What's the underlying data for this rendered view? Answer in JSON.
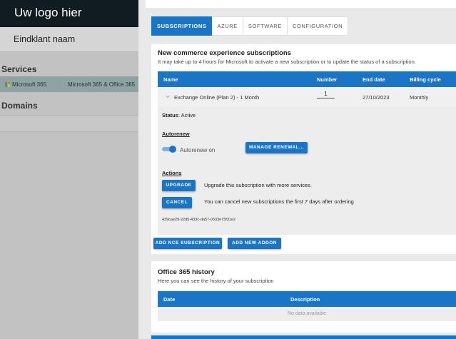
{
  "sidebar": {
    "logo": "Uw logo hier",
    "customer": "Eindklant naam",
    "services_heading": "Services",
    "service": {
      "name": "Microsoft 365",
      "type": "Microsoft 365 & Office 365"
    },
    "domains_heading": "Domains"
  },
  "tabs": [
    "SUBSCRIPTIONS",
    "AZURE",
    "SOFTWARE",
    "CONFIGURATION"
  ],
  "nce": {
    "title": "New commerce experience subscriptions",
    "subtitle": "It may take up to 4 hours for Microsoft to activate a new subscription or to update the status of a subscription.",
    "columns": [
      "Name",
      "Number",
      "End date",
      "Billing cycle"
    ],
    "row": {
      "name": "Exchange Online (Plan 2) - 1 Month",
      "number": "1",
      "end_date": "27/10/2023",
      "billing": "Monthly"
    },
    "status_label": "Status",
    "status_value": ": Active",
    "autorenew_heading": "Autorenew",
    "autorenew_label": "Autorenew on",
    "autorenew_on": true,
    "manage_renewal": "MANAGE RENEWAL...",
    "actions_heading": "Actions",
    "upgrade_button": "UPGRADE",
    "upgrade_text": "Upgrade this subscription with more services.",
    "cancel_button": "CANCEL",
    "cancel_text": "You can cancel new subscriptions the first 7 days after ordering",
    "subscription_id": "439cae29-22d5-433c-da57-0633e75f31e2",
    "add_nce": "ADD NCE SUBSCRIPTION",
    "add_addon": "ADD NEW ADDON"
  },
  "history": {
    "title": "Office 365 history",
    "subtitle": "Here you can see the history of your subscription",
    "columns": [
      "Date",
      "Description"
    ],
    "empty": "No data available"
  },
  "colors": {
    "accent": "#1a75c7",
    "sidebar_dark": "#101b22"
  },
  "icons": [
    "microsoft-logo-icon",
    "chevron-down-icon"
  ]
}
